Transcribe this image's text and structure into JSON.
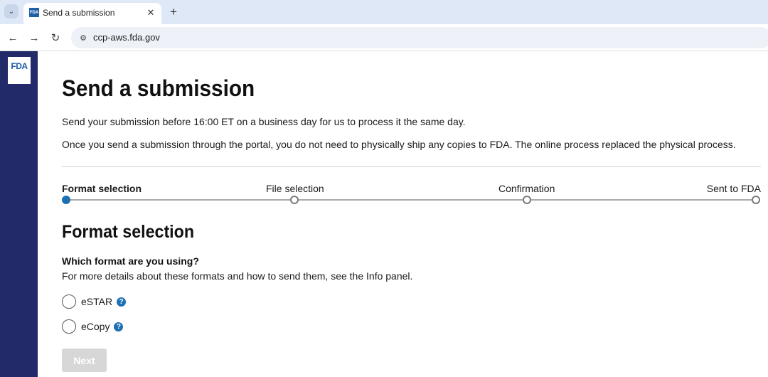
{
  "browser": {
    "tab_title": "Send a submission",
    "favicon_text": "FDA",
    "url": "ccp-aws.fda.gov"
  },
  "brand": {
    "logo_text": "FDA",
    "rail_color": "#232a69"
  },
  "page": {
    "title": "Send a submission",
    "intro_1": "Send your submission before 16:00 ET on a business day for us to process it the same day.",
    "intro_2": "Once you send a submission through the portal, you do not need to physically ship any copies to FDA. The online process replaced the physical process."
  },
  "stepper": {
    "active_index": 0,
    "steps": [
      {
        "label": "Format selection"
      },
      {
        "label": "File selection"
      },
      {
        "label": "Confirmation"
      },
      {
        "label": "Sent to FDA"
      }
    ]
  },
  "format_section": {
    "title": "Format selection",
    "question": "Which format are you using?",
    "help": "For more details about these formats and how to send them, see the Info panel.",
    "options": [
      {
        "label": "eSTAR",
        "selected": false
      },
      {
        "label": "eCopy",
        "selected": false
      }
    ]
  },
  "actions": {
    "next_label": "Next",
    "next_disabled": true
  },
  "colors": {
    "accent": "#1e6fb4",
    "disabled_button": "#d7d7d7"
  }
}
